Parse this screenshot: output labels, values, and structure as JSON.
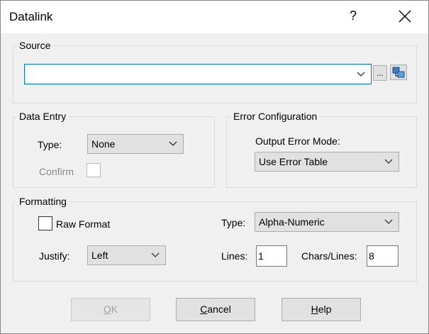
{
  "window": {
    "title": "Datalink",
    "help_glyph": "?"
  },
  "source": {
    "legend": "Source",
    "value": "",
    "browse_label": "..."
  },
  "data_entry": {
    "legend": "Data Entry",
    "type_label": "Type:",
    "type_value": "None",
    "confirm_label": "Confirm"
  },
  "error_config": {
    "legend": "Error Configuration",
    "mode_label": "Output Error Mode:",
    "mode_value": "Use Error Table"
  },
  "formatting": {
    "legend": "Formatting",
    "raw_format_label": "Raw Format",
    "type_label": "Type:",
    "type_value": "Alpha-Numeric",
    "justify_label": "Justify:",
    "justify_value": "Left",
    "lines_label": "Lines:",
    "lines_value": "1",
    "chars_label": "Chars/Lines:",
    "chars_value": "8"
  },
  "buttons": {
    "ok_first": "O",
    "ok_rest": "K",
    "cancel_first": "C",
    "cancel_rest": "ancel",
    "help_first": "H",
    "help_rest": "elp"
  },
  "colors": {
    "accent": "#0078d7",
    "field_bg": "#e1e1e1"
  }
}
